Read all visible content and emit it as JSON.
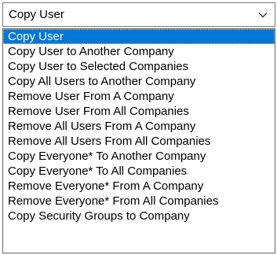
{
  "combo": {
    "value": "Copy User",
    "arrow_icon": "chevron-down-icon"
  },
  "dropdown": {
    "selected_index": 0,
    "items": [
      {
        "label": "Copy User"
      },
      {
        "label": "Copy User to Another Company"
      },
      {
        "label": "Copy User to Selected Companies"
      },
      {
        "label": "Copy All Users to Another Company"
      },
      {
        "label": "Remove User From A Company"
      },
      {
        "label": "Remove User From All Companies"
      },
      {
        "label": "Remove All Users From A Company"
      },
      {
        "label": "Remove All Users From All Companies"
      },
      {
        "label": "Copy Everyone* To Another Company"
      },
      {
        "label": "Copy Everyone* To All Companies"
      },
      {
        "label": "Remove Everyone* From A Company"
      },
      {
        "label": "Remove Everyone* From All Companies"
      },
      {
        "label": "Copy Security Groups to Company"
      }
    ]
  },
  "colors": {
    "selection_background": "#0078d7",
    "selection_text": "#ffffff",
    "border": "#7a7a7a"
  }
}
